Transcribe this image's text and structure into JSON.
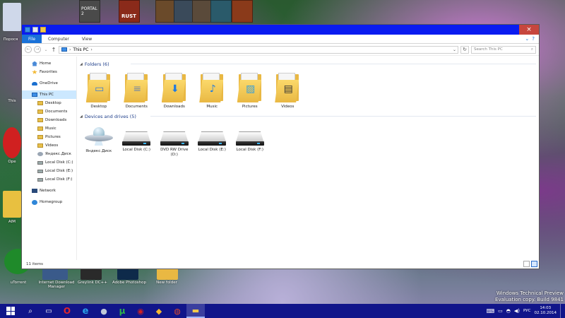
{
  "desktop": {
    "top_tiles": [
      {
        "label": "PORTAL 2",
        "color": "#4a4a4a"
      },
      {
        "label": "RUST",
        "color": "#8a2a1a"
      },
      {
        "label": "",
        "color": "#6a4a2a"
      },
      {
        "label": "",
        "color": "#3a4a5a"
      },
      {
        "label": "",
        "color": "#5a4a3a"
      },
      {
        "label": "",
        "color": "#2a5a6a"
      },
      {
        "label": "",
        "color": "#8a3a1a"
      }
    ],
    "left_labels": [
      {
        "text": "Порося"
      },
      {
        "text": "This"
      },
      {
        "text": "Ope"
      },
      {
        "text": "AIM"
      }
    ],
    "bottom_labels": [
      {
        "text": "uTorrent"
      },
      {
        "text": "Internet Download Manager"
      },
      {
        "text": "Greylink DC++"
      },
      {
        "text": "Adobe Photoshop"
      },
      {
        "text": "New folder"
      }
    ],
    "watermark": {
      "line1": "Windows Technical Preview",
      "line2": "Evaluation copy. Build 9841"
    }
  },
  "explorer": {
    "ribbon_tabs": [
      {
        "label": "File",
        "active": true
      },
      {
        "label": "Computer",
        "active": false
      },
      {
        "label": "View",
        "active": false
      }
    ],
    "close_glyph": "×",
    "address": {
      "back": "←",
      "forward": "→",
      "recent": "⌄",
      "up": "↑",
      "location": "This PC",
      "chevron": "›",
      "dropdown": "⌄",
      "refresh": "↻"
    },
    "search": {
      "placeholder": "Search This PC",
      "icon": "⌕"
    },
    "nav": {
      "home": "Home",
      "favorites": "Favorites",
      "onedrive": "OneDrive",
      "this_pc": "This PC",
      "pc_children": [
        "Desktop",
        "Documents",
        "Downloads",
        "Music",
        "Pictures",
        "Videos",
        "Яндекс.Диск",
        "Local Disk (C:)",
        "Local Disk (E:)",
        "Local Disk (F:)"
      ],
      "network": "Network",
      "homegroup": "Homegroup"
    },
    "folders_header": "Folders (6)",
    "folders": [
      {
        "label": "Desktop",
        "overlay": "▭",
        "overlay_color": "#3a7bd5"
      },
      {
        "label": "Documents",
        "overlay": "≡",
        "overlay_color": "#7a8aa0"
      },
      {
        "label": "Downloads",
        "overlay": "⬇",
        "overlay_color": "#1f7ae0"
      },
      {
        "label": "Music",
        "overlay": "♪",
        "overlay_color": "#1f7ae0"
      },
      {
        "label": "Pictures",
        "overlay": "▨",
        "overlay_color": "#3aa0d8"
      },
      {
        "label": "Videos",
        "overlay": "▤",
        "overlay_color": "#333333"
      }
    ],
    "drives_header": "Devices and drives (5)",
    "drives": [
      {
        "label": "Яндекс.Диск",
        "kind": "yandex"
      },
      {
        "label": "Local Disk (C:)",
        "kind": "disk"
      },
      {
        "label": "DVD RW Drive (D:)",
        "kind": "disk"
      },
      {
        "label": "Local Disk (E:)",
        "kind": "disk"
      },
      {
        "label": "Local Disk (F:)",
        "kind": "disk"
      }
    ],
    "status": "11 items"
  },
  "taskbar": {
    "items": [
      {
        "name": "search",
        "glyph": "⌕",
        "color": "#ffffff"
      },
      {
        "name": "task-view",
        "glyph": "▭",
        "color": "#ffffff"
      },
      {
        "name": "opera",
        "glyph": "O",
        "color": "#e0262b"
      },
      {
        "name": "internet-explorer",
        "glyph": "e",
        "color": "#2aa0e8"
      },
      {
        "name": "steam",
        "glyph": "●",
        "color": "#c0c8d8"
      },
      {
        "name": "utorrent",
        "glyph": "µ",
        "color": "#2fb34a"
      },
      {
        "name": "recorder",
        "glyph": "◉",
        "color": "#d02020"
      },
      {
        "name": "aimp",
        "glyph": "◆",
        "color": "#f2b731"
      },
      {
        "name": "chrome",
        "glyph": "◍",
        "color": "#e04a2a"
      },
      {
        "name": "file-explorer",
        "glyph": "▬",
        "color": "#f2c94c"
      }
    ],
    "language": "РУС",
    "time": "14:03",
    "date": "02.10.2014"
  }
}
